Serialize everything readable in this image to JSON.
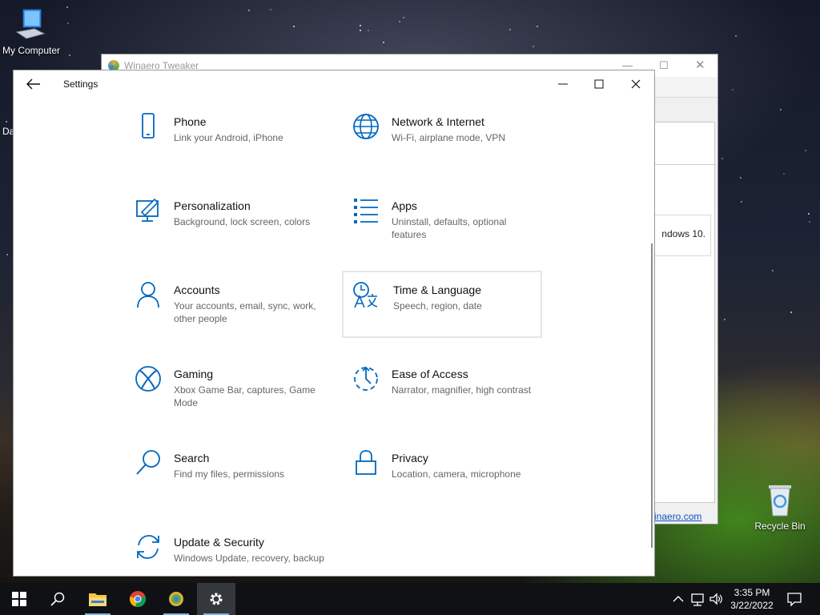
{
  "desktop": {
    "icons": [
      {
        "label": "My Computer"
      },
      {
        "label": "Recycle Bin"
      }
    ],
    "partial_text": "Da"
  },
  "winaero": {
    "title": "Winaero Tweaker",
    "fragment_text": "ndows 10.",
    "link_text": "inaero.com"
  },
  "settings": {
    "title": "Settings",
    "accent": "#0067c0",
    "tiles": [
      {
        "name": "Phone",
        "desc": "Link your Android, iPhone",
        "icon": "phone-icon"
      },
      {
        "name": "Network & Internet",
        "desc": "Wi-Fi, airplane mode, VPN",
        "icon": "globe-icon"
      },
      {
        "name": "Personalization",
        "desc": "Background, lock screen, colors",
        "icon": "personalization-icon"
      },
      {
        "name": "Apps",
        "desc": "Uninstall, defaults, optional features",
        "icon": "apps-list-icon"
      },
      {
        "name": "Accounts",
        "desc": "Your accounts, email, sync, work, other people",
        "icon": "person-icon"
      },
      {
        "name": "Time & Language",
        "desc": "Speech, region, date",
        "icon": "time-language-icon"
      },
      {
        "name": "Gaming",
        "desc": "Xbox Game Bar, captures, Game Mode",
        "icon": "xbox-icon"
      },
      {
        "name": "Ease of Access",
        "desc": "Narrator, magnifier, high contrast",
        "icon": "ease-of-access-icon"
      },
      {
        "name": "Search",
        "desc": "Find my files, permissions",
        "icon": "search-icon"
      },
      {
        "name": "Privacy",
        "desc": "Location, camera, microphone",
        "icon": "lock-icon"
      },
      {
        "name": "Update & Security",
        "desc": "Windows Update, recovery, backup",
        "icon": "update-icon"
      }
    ]
  },
  "taskbar": {
    "apps": [
      "start",
      "search",
      "file-explorer",
      "chrome",
      "winaero-tweaker",
      "settings"
    ],
    "clock": {
      "time": "3:35 PM",
      "date": "3/22/2022"
    }
  }
}
